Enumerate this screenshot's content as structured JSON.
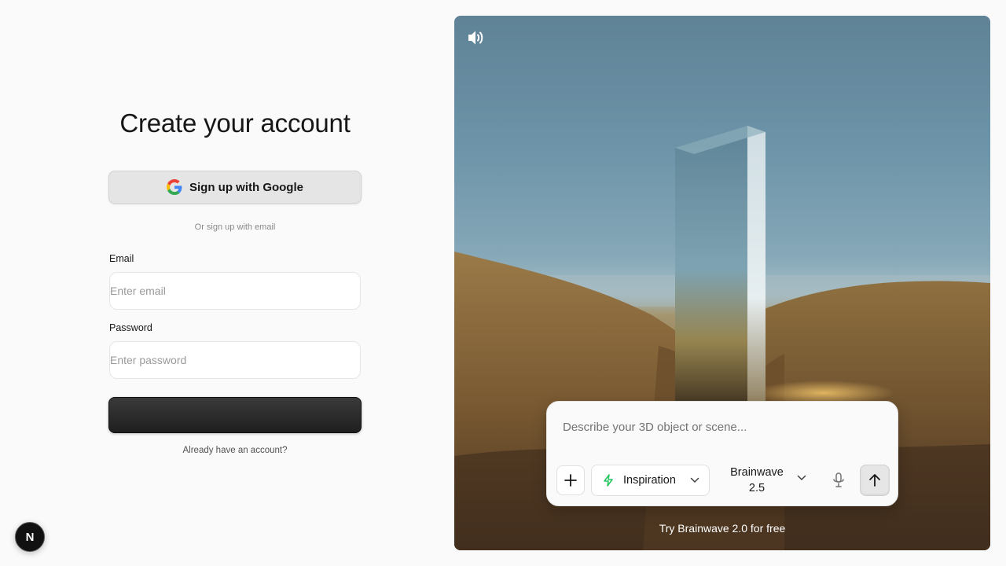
{
  "signup": {
    "title": "Create your account",
    "google_button_label": "Sign up with Google",
    "divider_text": "Or sign up with email",
    "email_label": "Email",
    "email_placeholder": "Enter email",
    "email_value": "",
    "password_label": "Password",
    "password_placeholder": "Enter password",
    "password_value": "",
    "submit_label": "",
    "signin_link": "Already have an account?"
  },
  "badge": {
    "letter": "N"
  },
  "hero": {
    "sound_icon": "speaker-volume-icon",
    "prompt": {
      "placeholder": "Describe your 3D object or scene...",
      "value": "",
      "add_icon": "plus-icon",
      "mode_icon": "lightning-bolt-icon",
      "mode_label": "Inspiration",
      "model_label": "Brainwave 2.5",
      "mic_icon": "microphone-icon",
      "send_icon": "arrow-up-icon"
    },
    "try_free_link": "Try Brainwave 2.0 for free"
  },
  "colors": {
    "page_background": "#fafafa",
    "primary_button": "#262626",
    "google_button": "#e5e5e5",
    "bolt_icon": "#22c55e"
  }
}
